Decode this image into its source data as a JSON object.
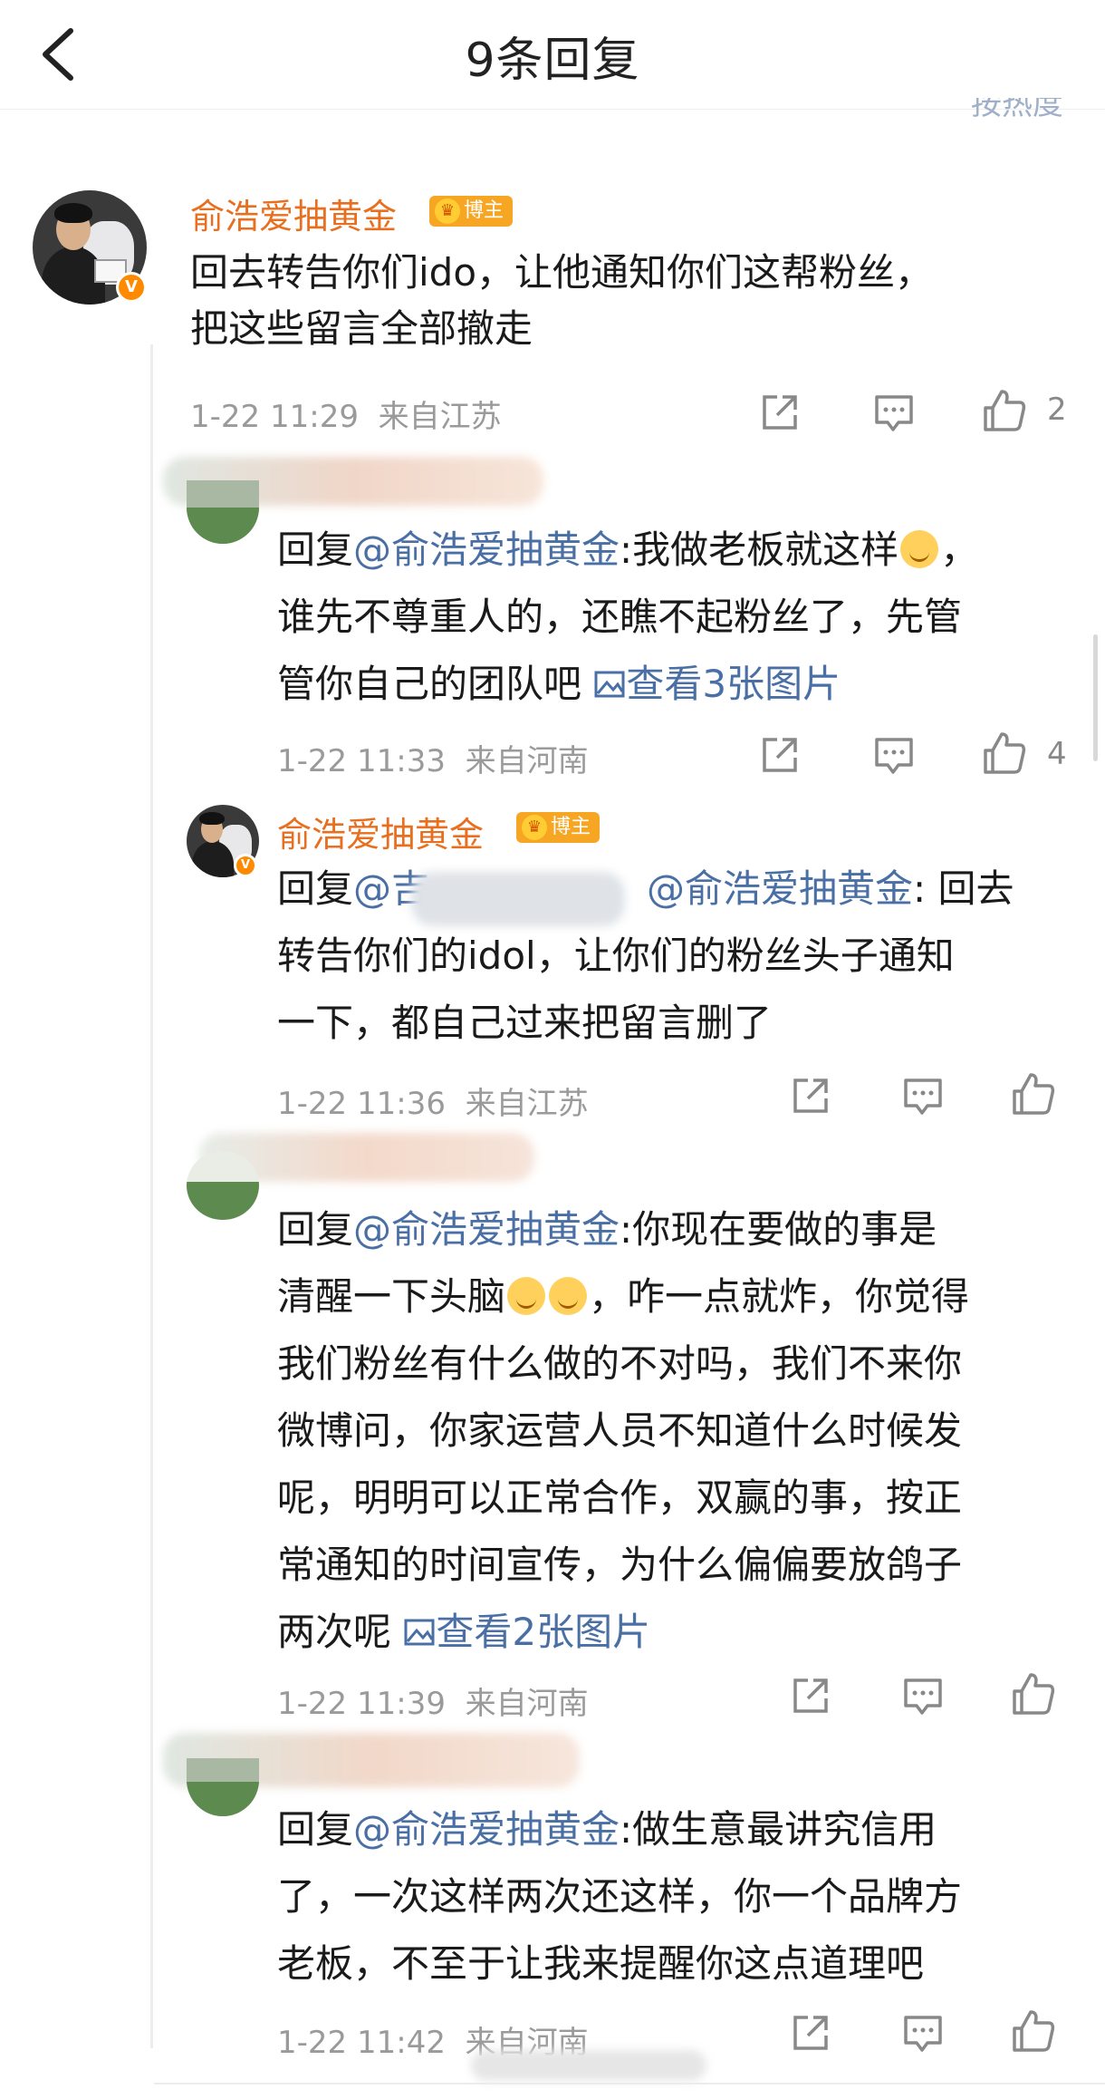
{
  "header": {
    "title": "9条回复",
    "sort_label": "按热度"
  },
  "icons": {
    "share": "share-icon",
    "comment": "comment-icon",
    "like": "thumbs-up-icon",
    "back": "chevron-left-icon"
  },
  "colors": {
    "name": "#e86f20",
    "mention": "#4a6fa5",
    "meta": "#9a9a9a",
    "host_badge": "#f6a623"
  },
  "root": {
    "author": "俞浩爱抽黄金",
    "badge": "博主",
    "verified": "V",
    "line1": "回去转告你们ido，让他通知你们这帮粉丝，",
    "line2": "把这些留言全部撤走",
    "time": "1-22 11:29",
    "location": "来自江苏",
    "likes": "2"
  },
  "reply1": {
    "prefix": "回复",
    "mention": "@俞浩爱抽黄金",
    "line1": ":我做老板就这样",
    "line1_end": "，",
    "line2": "谁先不尊重人的，还瞧不起粉丝了，先管",
    "line3": "管你自己的团队吧 ",
    "images_link": "查看3张图片",
    "time": "1-22 11:33",
    "location": "来自河南",
    "likes": "4"
  },
  "reply2": {
    "author": "俞浩爱抽黄金",
    "badge": "博主",
    "prefix": "回复",
    "mention_partial": "@吉",
    "mention": "@俞浩爱抽黄金",
    "line1_end": ": 回去",
    "line2": "转告你们的idol，让你们的粉丝头子通知",
    "line3": "一下，都自己过来把留言删了",
    "time": "1-22 11:36",
    "location": "来自江苏"
  },
  "reply3": {
    "prefix": "回复",
    "mention": "@俞浩爱抽黄金",
    "line1": ":你现在要做的事是",
    "line2a": "清醒一下头脑",
    "line2b": "，咋一点就炸，你觉得",
    "line3": "我们粉丝有什么做的不对吗，我们不来你",
    "line4": "微博问，你家运营人员不知道什么时候发",
    "line5": "呢，明明可以正常合作，双赢的事，按正",
    "line6": "常通知的时间宣传，为什么偏偏要放鸽子",
    "line7": "两次呢 ",
    "images_link": "查看2张图片",
    "time": "1-22 11:39",
    "location": "来自河南"
  },
  "reply4": {
    "prefix": "回复",
    "mention": "@俞浩爱抽黄金",
    "line1": ":做生意最讲究信用",
    "line2": "了，一次这样两次还这样，你一个品牌方",
    "line3": "老板，不至于让我来提醒你这点道理吧",
    "time": "1-22 11:42",
    "location": "来自河南"
  }
}
